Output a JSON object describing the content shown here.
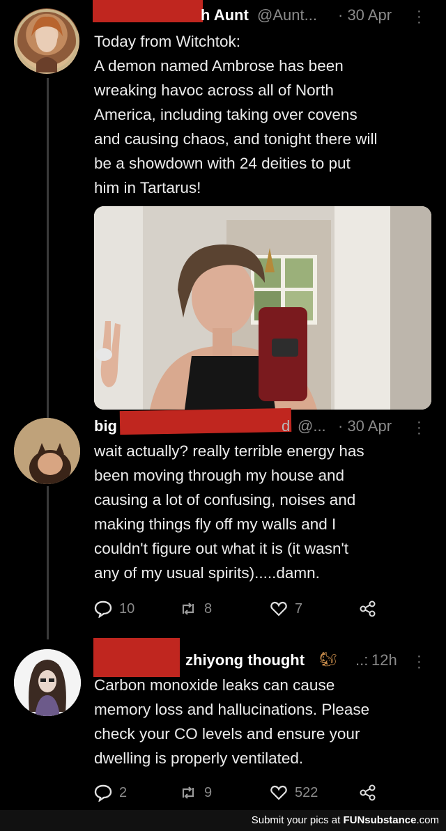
{
  "tweets": [
    {
      "name": "h Aunt",
      "handle": "@Aunt...",
      "time": "· 30 Apr",
      "lines": [
        "Today from Witchtok:",
        "A demon named Ambrose has been",
        "wreaking havoc across all of North",
        "America, including taking over covens",
        "and causing chaos, and tonight there will",
        "be a showdown with 24 deities to put",
        "him in Tartarus!"
      ]
    },
    {
      "name_start": "big",
      "name_end": "d",
      "handle": "@...",
      "time": "· 30 Apr",
      "lines": [
        "wait actually? really terrible energy has",
        "been moving through my house and",
        "causing a lot of confusing, noises and",
        "making things fly off my walls and I",
        "couldn't figure out what it is (it wasn't",
        "any of my usual spirits).....damn."
      ],
      "replies": "10",
      "retweets": "8",
      "likes": "7"
    },
    {
      "name": "zhiyong thought",
      "handle": "..:",
      "time": "12h",
      "lines": [
        "Carbon monoxide leaks can cause",
        "memory loss and hallucinations. Please",
        "check your CO levels and ensure your",
        "dwelling is properly ventilated."
      ],
      "replies": "2",
      "retweets": "9",
      "likes": "522"
    }
  ],
  "footer": {
    "prefix": "Submit your pics at ",
    "brand": "FUNsubstance",
    "suffix": ".com"
  },
  "icons": {
    "more": "more-dots-icon",
    "reply": "reply-icon",
    "retweet": "retweet-icon",
    "like": "heart-icon",
    "share": "share-icon",
    "emoji": "squirrel-emoji-icon"
  },
  "colors": {
    "redaction": "#c0261f",
    "background": "#000000",
    "muted": "#8a8a8a"
  }
}
